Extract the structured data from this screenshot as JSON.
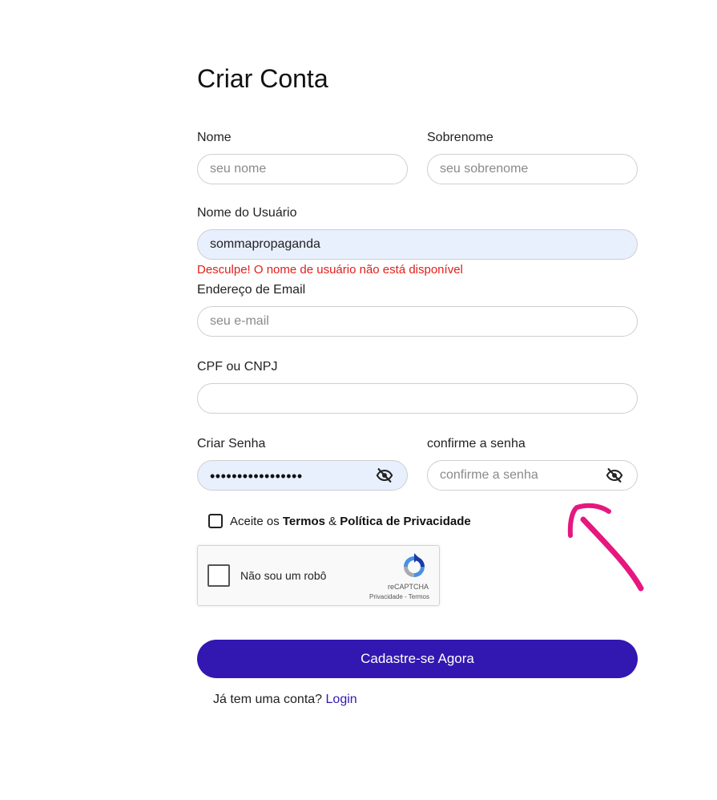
{
  "title": "Criar Conta",
  "fields": {
    "first_name": {
      "label": "Nome",
      "placeholder": "seu nome",
      "value": ""
    },
    "last_name": {
      "label": "Sobrenome",
      "placeholder": "seu sobrenome",
      "value": ""
    },
    "username": {
      "label": "Nome do Usuário",
      "value": "sommapropaganda",
      "error": "Desculpe! O nome de usuário não está disponível"
    },
    "email": {
      "label": "Endereço de Email",
      "placeholder": "seu e-mail",
      "value": ""
    },
    "document": {
      "label": "CPF ou CNPJ",
      "placeholder": "",
      "value": ""
    },
    "password": {
      "label": "Criar Senha",
      "masked_value": "•••••••••••••••••"
    },
    "confirm_password": {
      "label": "confirme a senha",
      "placeholder": "confirme a senha"
    }
  },
  "terms": {
    "prefix": "Aceite os ",
    "terms_link": "Termos",
    "ampersand": " & ",
    "privacy_link": "Política de Privacidade",
    "checked": false
  },
  "recaptcha": {
    "label": "Não sou um robô",
    "brand": "reCAPTCHA",
    "links": "Privacidade - Termos"
  },
  "submit_label": "Cadastre-se Agora",
  "login_prompt": {
    "text": "Já tem uma conta? ",
    "link": "Login"
  },
  "colors": {
    "primary": "#3317b1",
    "error": "#e0201b",
    "autofill_bg": "#e8effd",
    "annotation": "#e6177f"
  },
  "icons": {
    "password_toggle": "eye-slash-icon",
    "annotation": "hand-drawn-arrow"
  }
}
